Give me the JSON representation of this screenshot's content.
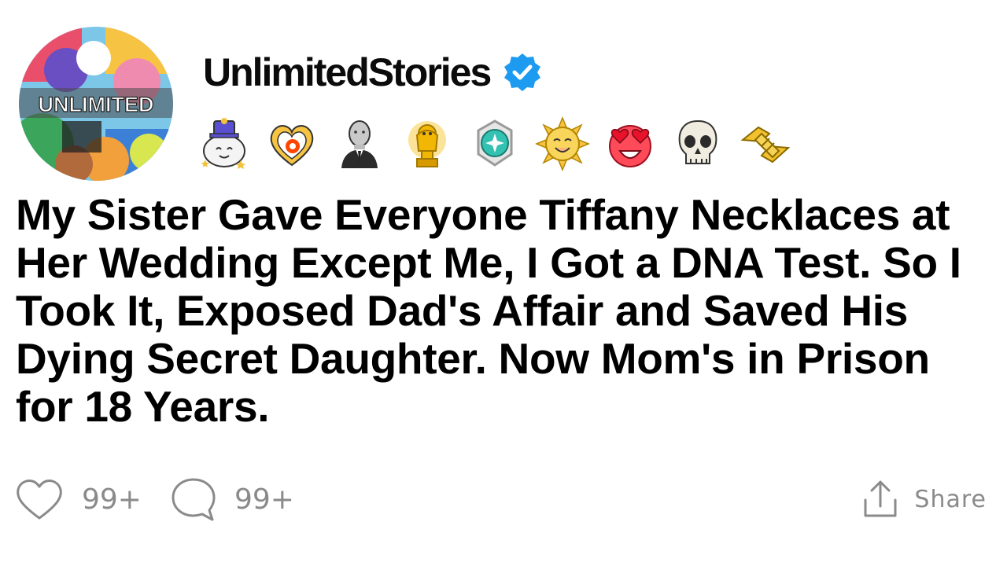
{
  "channel": {
    "name": "UnlimitedStories",
    "avatar_label": "UNLIMITED",
    "verified_icon": "verified-check-icon",
    "verified_color": "#1d9bf0"
  },
  "awards": [
    {
      "icon": "wholesome-award-icon"
    },
    {
      "icon": "heartwarming-award-icon"
    },
    {
      "icon": "stonks-meme-award-icon"
    },
    {
      "icon": "gold-award-icon"
    },
    {
      "icon": "platinum-award-icon"
    },
    {
      "icon": "sun-smile-award-icon"
    },
    {
      "icon": "heart-eyes-award-icon"
    },
    {
      "icon": "skull-award-icon"
    },
    {
      "icon": "handshake-award-icon"
    }
  ],
  "post": {
    "title": "My Sister Gave Everyone Tiffany Necklaces at Her Wedding Except Me, I Got a DNA Test. So I Took It, Exposed Dad's Affair and Saved His Dying Secret Daughter. Now Mom's in Prison for 18 Years."
  },
  "footer": {
    "likes_count": "99+",
    "comments_count": "99+",
    "share_label": "Share"
  },
  "colors": {
    "text": "#000000",
    "muted": "#8a8a8a",
    "background": "#ffffff"
  }
}
